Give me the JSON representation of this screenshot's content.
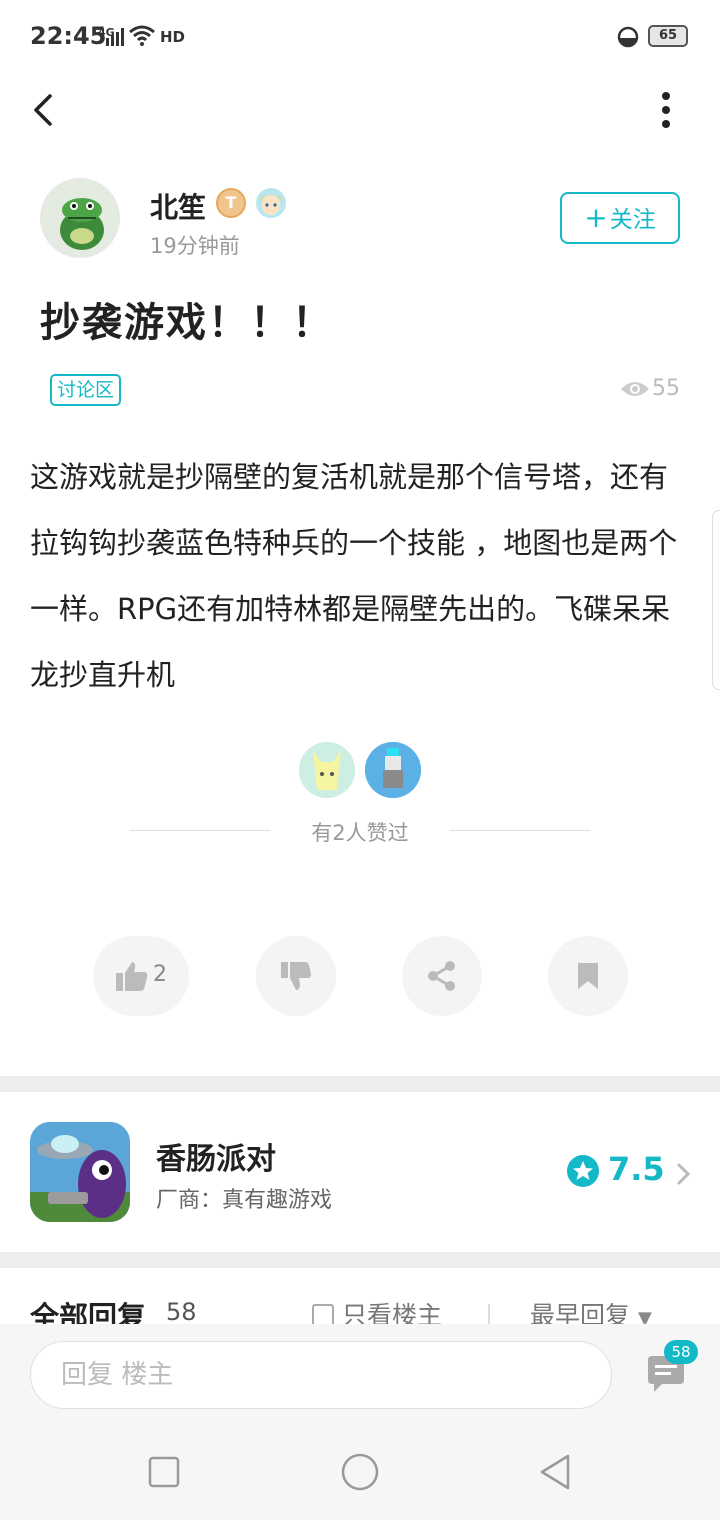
{
  "status_bar": {
    "time": "22:45",
    "network": "4G",
    "hd": "HD",
    "battery": "65"
  },
  "author": {
    "name": "北笙",
    "level": "T",
    "time_ago": "19分钟前",
    "follow_label": "关注"
  },
  "post": {
    "title": "抄袭游戏！！！",
    "tag": "讨论区",
    "views": "55",
    "body": "这游戏就是抄隔壁的复活机就是那个信号塔，还有拉钩钩抄袭蓝色特种兵的一个技能 ，地图也是两个一样。RPG还有加特林都是隔壁先出的。飞碟呆呆龙抄直升机"
  },
  "likes": {
    "text": "有2人赞过"
  },
  "actions": {
    "like_count": "2"
  },
  "game": {
    "name": "香肠派对",
    "vendor": "厂商：真有趣游戏",
    "score": "7.5"
  },
  "replies": {
    "title": "全部回复",
    "count": "58",
    "only_op": "只看楼主",
    "sort": "最早回复"
  },
  "reply_bar": {
    "placeholder": "回复  楼主",
    "comment_count": "58"
  },
  "colors": {
    "accent": "#14b9c8",
    "text": "#222222",
    "muted": "#999999",
    "divider": "#eeeeee"
  }
}
